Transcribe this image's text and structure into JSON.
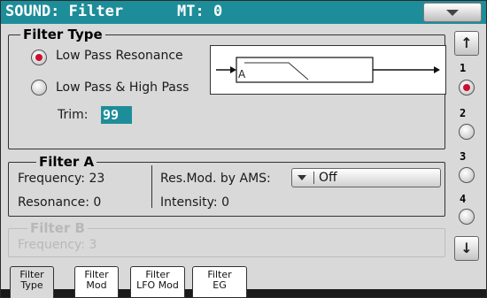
{
  "titlebar": {
    "title": "SOUND: Filter",
    "mt": "MT: 0"
  },
  "filter_type": {
    "legend": "Filter Type",
    "options": [
      {
        "label": "Low Pass Resonance",
        "selected": true
      },
      {
        "label": "Low Pass & High Pass",
        "selected": false
      }
    ],
    "trim_label": "Trim:",
    "trim_value": "99",
    "diagram_label": "A"
  },
  "filter_a": {
    "legend": "Filter A",
    "frequency": "Frequency: 23",
    "resonance": "Resonance: 0",
    "res_mod_label": "Res.Mod. by AMS:",
    "res_mod_value": "Off",
    "intensity": "Intensity: 0"
  },
  "filter_b": {
    "legend": "Filter B",
    "frequency": "Frequency: 3"
  },
  "sidebar": {
    "numbers": [
      "1",
      "2",
      "3",
      "4"
    ],
    "selected": 1
  },
  "tabs": [
    {
      "line1": "Filter",
      "line2": "Type",
      "active": true
    },
    {
      "line1": "Filter",
      "line2": "Mod",
      "active": false
    },
    {
      "line1": "Filter",
      "line2": "LFO Mod",
      "active": false
    },
    {
      "line1": "Filter",
      "line2": "EG",
      "active": false
    }
  ],
  "colors": {
    "title_bg": "#1d8d9a",
    "radio_dot": "#c8102e",
    "disabled": "#b8b8b8"
  }
}
